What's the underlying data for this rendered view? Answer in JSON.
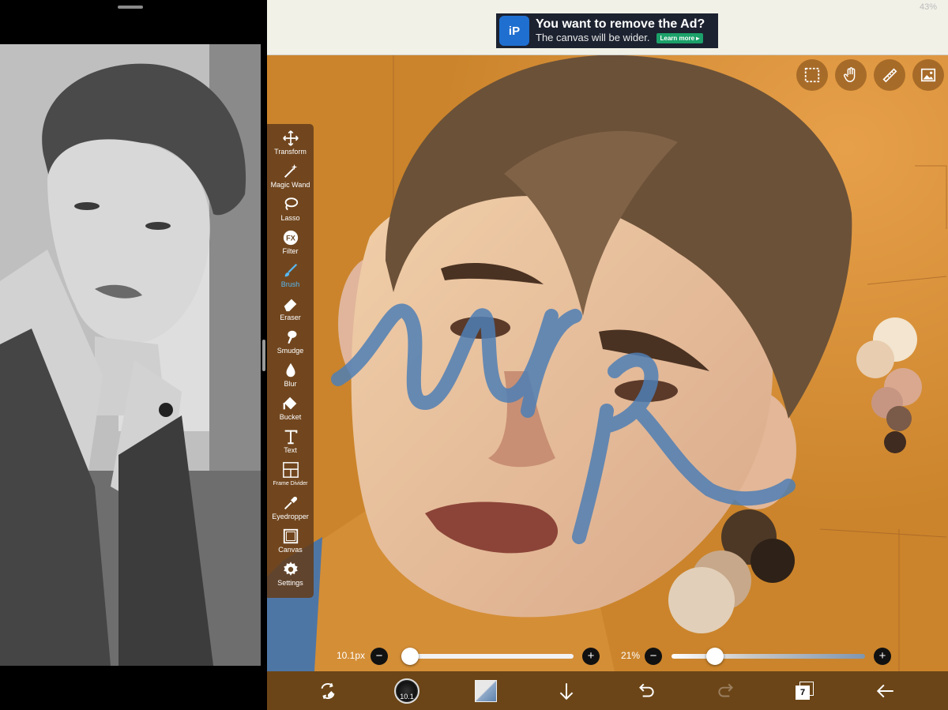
{
  "status": {
    "battery": "43%"
  },
  "ad": {
    "logo_text": "iP",
    "title": "You want to remove the Ad?",
    "subtitle": "The canvas will be wider.",
    "cta": "Learn more ▸"
  },
  "canvas": {
    "watermark": "wip"
  },
  "top_buttons": [
    {
      "icon": "selection-icon"
    },
    {
      "icon": "hand-icon"
    },
    {
      "icon": "ruler-icon"
    },
    {
      "icon": "image-icon"
    }
  ],
  "tools": [
    {
      "label": "Transform",
      "icon": "transform-icon"
    },
    {
      "label": "Magic Wand",
      "icon": "magic-wand-icon"
    },
    {
      "label": "Lasso",
      "icon": "lasso-icon"
    },
    {
      "label": "Filter",
      "icon": "filter-icon"
    },
    {
      "label": "Brush",
      "icon": "brush-icon",
      "active": true
    },
    {
      "label": "Eraser",
      "icon": "eraser-icon"
    },
    {
      "label": "Smudge",
      "icon": "smudge-icon"
    },
    {
      "label": "Blur",
      "icon": "blur-icon"
    },
    {
      "label": "Bucket",
      "icon": "bucket-icon"
    },
    {
      "label": "Text",
      "icon": "text-icon"
    },
    {
      "label": "Frame Divider",
      "icon": "frame-divider-icon"
    },
    {
      "label": "Eyedropper",
      "icon": "eyedropper-icon"
    },
    {
      "label": "Canvas",
      "icon": "canvas-icon"
    },
    {
      "label": "Settings",
      "icon": "gear-icon"
    }
  ],
  "sliders": {
    "brush_size": {
      "value_label": "10.1px",
      "minus": "−",
      "plus": "+"
    },
    "opacity": {
      "value_label": "21%",
      "minus": "−",
      "plus": "+"
    }
  },
  "bottom_bar": {
    "brush_size_badge": "10.1",
    "layers_count": "7"
  },
  "colors": {
    "accent": "#58b7f0",
    "canvas_bg": "#cf8a2e",
    "bottom_bar": "#6b4517",
    "watermark": "#4f7fb5"
  }
}
